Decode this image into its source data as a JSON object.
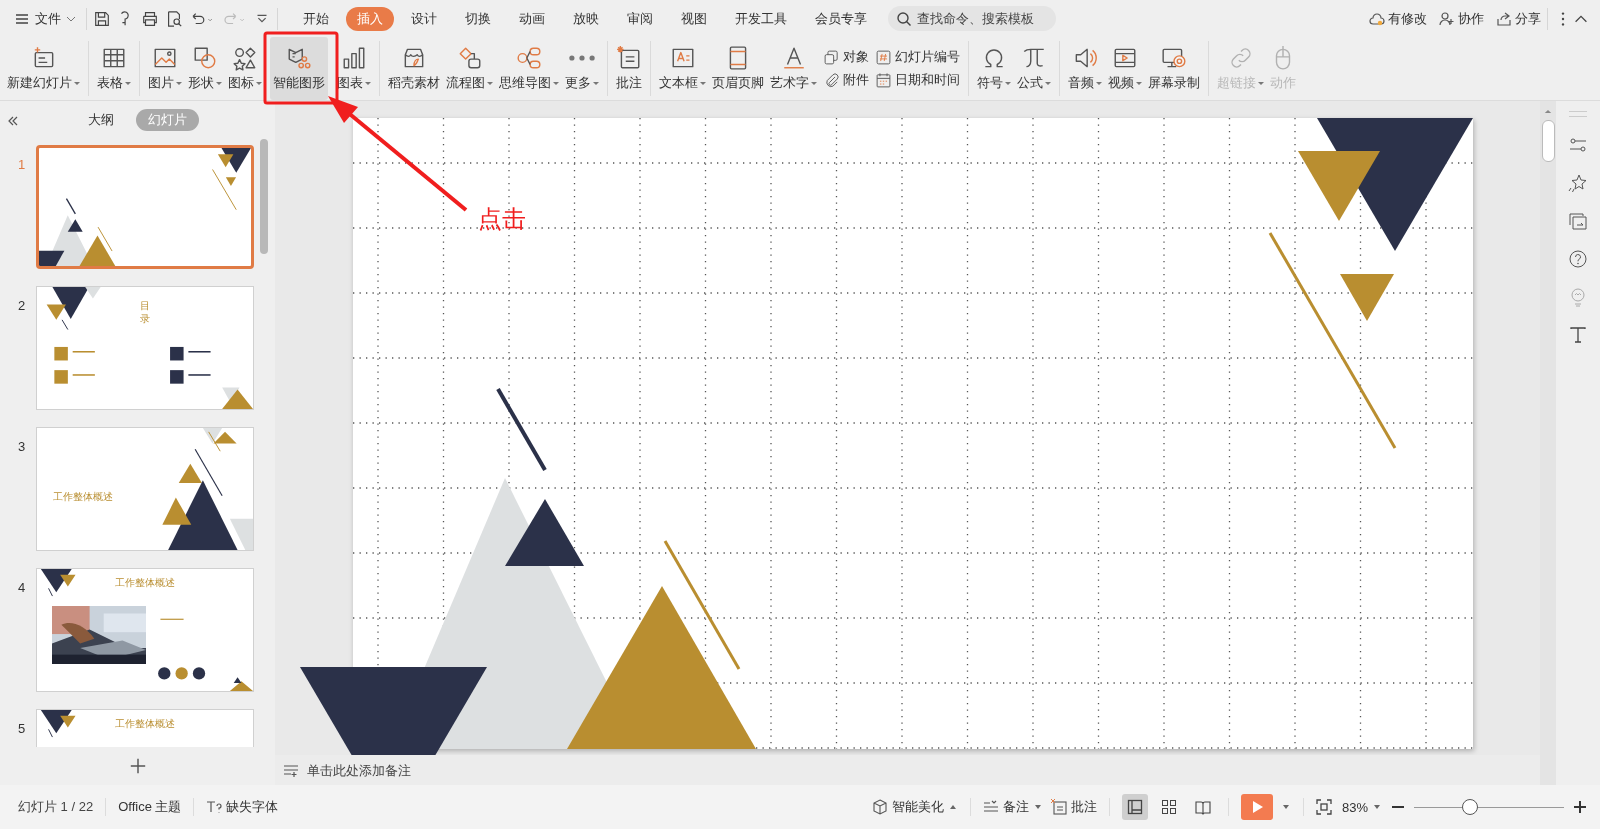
{
  "menu_bar": {
    "file_menu": "文件",
    "tabs": [
      {
        "label": "开始",
        "selected": false
      },
      {
        "label": "插入",
        "selected": true
      },
      {
        "label": "设计",
        "selected": false
      },
      {
        "label": "切换",
        "selected": false
      },
      {
        "label": "动画",
        "selected": false
      },
      {
        "label": "放映",
        "selected": false
      },
      {
        "label": "审阅",
        "selected": false
      },
      {
        "label": "视图",
        "selected": false
      },
      {
        "label": "开发工具",
        "selected": false
      },
      {
        "label": "会员专享",
        "selected": false
      }
    ],
    "search": {
      "placeholder": "查找命令、搜索模板"
    },
    "actions": [
      "有修改",
      "协作",
      "分享"
    ]
  },
  "ribbon": {
    "groups": [
      [
        {
          "kind": "large",
          "label": "新建幻灯片",
          "dropdown": true,
          "disabled": false,
          "highlighted": false
        }
      ],
      [
        {
          "kind": "large",
          "label": "表格",
          "dropdown": true,
          "disabled": false,
          "highlighted": false
        }
      ],
      [
        {
          "kind": "large",
          "label": "图片",
          "dropdown": true,
          "disabled": false,
          "highlighted": false
        },
        {
          "kind": "large",
          "label": "形状",
          "dropdown": true,
          "disabled": false,
          "highlighted": false
        },
        {
          "kind": "large",
          "label": "图标",
          "dropdown": true,
          "disabled": false,
          "highlighted": false
        },
        {
          "kind": "large",
          "label": "智能图形",
          "dropdown": false,
          "disabled": false,
          "highlighted": true
        },
        {
          "kind": "large",
          "label": "图表",
          "dropdown": true,
          "disabled": false,
          "highlighted": false
        }
      ],
      [
        {
          "kind": "large",
          "label": "稻壳素材",
          "dropdown": false,
          "disabled": false,
          "highlighted": false
        },
        {
          "kind": "large",
          "label": "流程图",
          "dropdown": true,
          "disabled": false,
          "highlighted": false
        },
        {
          "kind": "large",
          "label": "思维导图",
          "dropdown": true,
          "disabled": false,
          "highlighted": false
        },
        {
          "kind": "large",
          "label": "更多",
          "dropdown": true,
          "disabled": false,
          "highlighted": false
        }
      ],
      [
        {
          "kind": "large",
          "label": "批注",
          "dropdown": false,
          "disabled": false,
          "highlighted": false
        }
      ],
      [
        {
          "kind": "large",
          "label": "文本框",
          "dropdown": true,
          "disabled": false,
          "highlighted": false
        },
        {
          "kind": "large",
          "label": "页眉页脚",
          "dropdown": false,
          "disabled": false,
          "highlighted": false
        },
        {
          "kind": "large",
          "label": "艺术字",
          "dropdown": true,
          "disabled": false,
          "highlighted": false
        },
        {
          "kind": "stack",
          "items": [
            {
              "label": "对象"
            },
            {
              "label": "附件"
            }
          ]
        },
        {
          "kind": "stack",
          "items": [
            {
              "label": "幻灯片编号"
            },
            {
              "label": "日期和时间"
            }
          ]
        }
      ],
      [
        {
          "kind": "large",
          "label": "符号",
          "dropdown": true,
          "disabled": false,
          "highlighted": false
        },
        {
          "kind": "large",
          "label": "公式",
          "dropdown": true,
          "disabled": false,
          "highlighted": false
        }
      ],
      [
        {
          "kind": "large",
          "label": "音频",
          "dropdown": true,
          "disabled": false,
          "highlighted": false
        },
        {
          "kind": "large",
          "label": "视频",
          "dropdown": true,
          "disabled": false,
          "highlighted": false
        },
        {
          "kind": "large",
          "label": "屏幕录制",
          "dropdown": false,
          "disabled": false,
          "highlighted": false
        }
      ],
      [
        {
          "kind": "large",
          "label": "超链接",
          "dropdown": true,
          "disabled": true,
          "highlighted": false
        },
        {
          "kind": "large",
          "label": "动作",
          "dropdown": false,
          "disabled": true,
          "highlighted": false
        }
      ]
    ]
  },
  "slide_panel": {
    "tabs": [
      {
        "label": "大纲",
        "selected": false
      },
      {
        "label": "幻灯片",
        "selected": true
      }
    ],
    "slides": [
      {
        "number": "1",
        "selected": true
      },
      {
        "number": "2",
        "selected": false,
        "title": "目录"
      },
      {
        "number": "3",
        "selected": false,
        "title": "工作整体概述"
      },
      {
        "number": "4",
        "selected": false,
        "title": "工作整体概述"
      },
      {
        "number": "5",
        "selected": false,
        "title": "工作整体概述"
      }
    ]
  },
  "notes": {
    "placeholder": "单击此处添加备注"
  },
  "annotation": {
    "label": "点击"
  },
  "status_bar": {
    "slide_counter": "幻灯片 1 / 22",
    "theme": "Office 主题",
    "missing_fonts": "缺失字体",
    "beautify": "智能美化",
    "notes": "备注",
    "comments": "批注",
    "views": [
      {
        "selected": true
      },
      {
        "selected": false
      },
      {
        "selected": false
      }
    ],
    "zoom": {
      "reading": "83%",
      "level": 0.37
    }
  }
}
